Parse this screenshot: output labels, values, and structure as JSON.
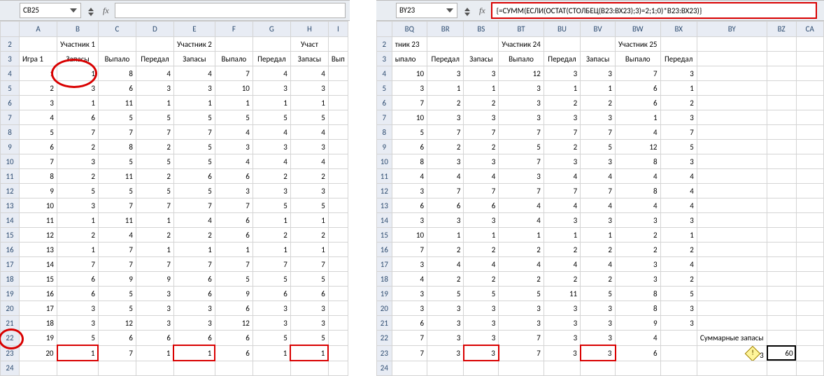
{
  "left": {
    "namebox": "CB25",
    "fx_symbol": "fx",
    "formula": "",
    "col_headers": [
      "A",
      "B",
      "C",
      "D",
      "E",
      "F",
      "G",
      "H",
      "I"
    ],
    "merged_headers_row2": [
      "",
      "Участник 1",
      "",
      "",
      "Участник 2",
      "",
      "",
      "Участ"
    ],
    "row2_first": "",
    "headers_row3": [
      "Игра 1",
      "Запасы",
      "Выпало",
      "Передал",
      "Запасы",
      "Выпало",
      "Передал",
      "Запасы",
      "Вып"
    ],
    "rows": [
      {
        "n": 4,
        "cells": [
          "1",
          "1",
          "8",
          "4",
          "4",
          "7",
          "4",
          "4",
          ""
        ]
      },
      {
        "n": 5,
        "cells": [
          "2",
          "3",
          "6",
          "3",
          "3",
          "10",
          "3",
          "3",
          ""
        ]
      },
      {
        "n": 6,
        "cells": [
          "3",
          "1",
          "11",
          "1",
          "1",
          "1",
          "1",
          "1",
          ""
        ]
      },
      {
        "n": 7,
        "cells": [
          "4",
          "6",
          "5",
          "5",
          "5",
          "5",
          "5",
          "5",
          ""
        ]
      },
      {
        "n": 8,
        "cells": [
          "5",
          "7",
          "7",
          "7",
          "7",
          "4",
          "4",
          "4",
          ""
        ]
      },
      {
        "n": 9,
        "cells": [
          "6",
          "2",
          "8",
          "2",
          "5",
          "3",
          "3",
          "3",
          ""
        ]
      },
      {
        "n": 10,
        "cells": [
          "7",
          "3",
          "5",
          "5",
          "5",
          "4",
          "4",
          "4",
          ""
        ]
      },
      {
        "n": 11,
        "cells": [
          "8",
          "2",
          "11",
          "2",
          "6",
          "6",
          "2",
          "2",
          ""
        ]
      },
      {
        "n": 12,
        "cells": [
          "9",
          "5",
          "5",
          "5",
          "5",
          "3",
          "3",
          "3",
          ""
        ]
      },
      {
        "n": 13,
        "cells": [
          "10",
          "3",
          "7",
          "7",
          "7",
          "7",
          "5",
          "5",
          ""
        ]
      },
      {
        "n": 14,
        "cells": [
          "11",
          "1",
          "11",
          "1",
          "4",
          "6",
          "1",
          "1",
          ""
        ]
      },
      {
        "n": 15,
        "cells": [
          "12",
          "2",
          "4",
          "2",
          "2",
          "6",
          "2",
          "2",
          ""
        ]
      },
      {
        "n": 16,
        "cells": [
          "13",
          "1",
          "7",
          "1",
          "1",
          "1",
          "1",
          "1",
          ""
        ]
      },
      {
        "n": 17,
        "cells": [
          "14",
          "7",
          "7",
          "7",
          "7",
          "7",
          "7",
          "7",
          ""
        ]
      },
      {
        "n": 18,
        "cells": [
          "15",
          "6",
          "9",
          "9",
          "6",
          "5",
          "5",
          "5",
          ""
        ]
      },
      {
        "n": 19,
        "cells": [
          "16",
          "6",
          "5",
          "3",
          "6",
          "9",
          "6",
          "6",
          ""
        ]
      },
      {
        "n": 20,
        "cells": [
          "17",
          "3",
          "5",
          "3",
          "3",
          "6",
          "3",
          "3",
          ""
        ]
      },
      {
        "n": 21,
        "cells": [
          "18",
          "3",
          "12",
          "3",
          "3",
          "12",
          "3",
          "3",
          ""
        ]
      },
      {
        "n": 22,
        "cells": [
          "19",
          "5",
          "6",
          "6",
          "6",
          "6",
          "5",
          "5",
          ""
        ]
      },
      {
        "n": 23,
        "cells": [
          "20",
          "1",
          "7",
          "1",
          "1",
          "6",
          "1",
          "1",
          ""
        ]
      },
      {
        "n": 24,
        "cells": [
          "",
          "",
          "",
          "",
          "",
          "",
          "",
          "",
          ""
        ]
      }
    ]
  },
  "right": {
    "namebox": "BY23",
    "fx_symbol": "fx",
    "formula": "{=СУММ(ЕСЛИ(ОСТАТ(СТОЛБЕЦ(B23:BX23);3)=2;1;0)*B23:BX23)}",
    "col_headers": [
      "BQ",
      "BR",
      "BS",
      "BT",
      "BU",
      "BV",
      "BW",
      "BX",
      "BY",
      "BZ",
      "CA"
    ],
    "merged_headers_row2": [
      "тник 23",
      "",
      "",
      "Участник 24",
      "",
      "",
      "Участник 25",
      "",
      "",
      "",
      ""
    ],
    "headers_row3": [
      "ыпало",
      "Передал",
      "Запасы",
      "Выпало",
      "Передал",
      "Запасы",
      "Выпало",
      "Передал",
      "",
      "",
      ""
    ],
    "rows": [
      {
        "n": 4,
        "cells": [
          "10",
          "3",
          "3",
          "12",
          "3",
          "3",
          "7",
          "3",
          "",
          "",
          ""
        ]
      },
      {
        "n": 5,
        "cells": [
          "3",
          "1",
          "1",
          "3",
          "1",
          "1",
          "6",
          "1",
          "",
          "",
          ""
        ]
      },
      {
        "n": 6,
        "cells": [
          "7",
          "2",
          "2",
          "3",
          "2",
          "2",
          "6",
          "2",
          "",
          "",
          ""
        ]
      },
      {
        "n": 7,
        "cells": [
          "10",
          "3",
          "3",
          "3",
          "3",
          "3",
          "1",
          "3",
          "",
          "",
          ""
        ]
      },
      {
        "n": 8,
        "cells": [
          "5",
          "7",
          "7",
          "7",
          "7",
          "7",
          "4",
          "7",
          "",
          "",
          ""
        ]
      },
      {
        "n": 9,
        "cells": [
          "6",
          "2",
          "2",
          "5",
          "2",
          "5",
          "12",
          "5",
          "",
          "",
          ""
        ]
      },
      {
        "n": 10,
        "cells": [
          "8",
          "3",
          "3",
          "7",
          "3",
          "3",
          "8",
          "3",
          "",
          "",
          ""
        ]
      },
      {
        "n": 11,
        "cells": [
          "4",
          "4",
          "4",
          "3",
          "4",
          "4",
          "4",
          "4",
          "",
          "",
          ""
        ]
      },
      {
        "n": 12,
        "cells": [
          "3",
          "7",
          "7",
          "7",
          "7",
          "7",
          "8",
          "4",
          "",
          "",
          ""
        ]
      },
      {
        "n": 13,
        "cells": [
          "6",
          "6",
          "6",
          "4",
          "4",
          "4",
          "4",
          "4",
          "",
          "",
          ""
        ]
      },
      {
        "n": 14,
        "cells": [
          "3",
          "3",
          "3",
          "4",
          "3",
          "3",
          "3",
          "3",
          "",
          "",
          ""
        ]
      },
      {
        "n": 15,
        "cells": [
          "10",
          "1",
          "1",
          "1",
          "1",
          "1",
          "2",
          "1",
          "",
          "",
          ""
        ]
      },
      {
        "n": 16,
        "cells": [
          "7",
          "2",
          "2",
          "2",
          "2",
          "2",
          "2",
          "2",
          "",
          "",
          ""
        ]
      },
      {
        "n": 17,
        "cells": [
          "3",
          "4",
          "4",
          "4",
          "4",
          "4",
          "3",
          "4",
          "",
          "",
          ""
        ]
      },
      {
        "n": 18,
        "cells": [
          "4",
          "2",
          "2",
          "2",
          "2",
          "2",
          "3",
          "2",
          "",
          "",
          ""
        ]
      },
      {
        "n": 19,
        "cells": [
          "3",
          "5",
          "5",
          "5",
          "11",
          "5",
          "8",
          "5",
          "",
          "",
          ""
        ]
      },
      {
        "n": 20,
        "cells": [
          "3",
          "3",
          "3",
          "3",
          "3",
          "3",
          "8",
          "3",
          "",
          "",
          ""
        ]
      },
      {
        "n": 21,
        "cells": [
          "6",
          "3",
          "3",
          "3",
          "3",
          "3",
          "9",
          "3",
          "",
          "",
          ""
        ]
      },
      {
        "n": 22,
        "cells": [
          "7",
          "3",
          "3",
          "7",
          "3",
          "3",
          "4",
          "",
          "Суммарные запасы",
          "",
          ""
        ]
      },
      {
        "n": 23,
        "cells": [
          "7",
          "3",
          "3",
          "7",
          "3",
          "3",
          "6",
          "",
          "3",
          "60",
          ""
        ]
      },
      {
        "n": 24,
        "cells": [
          "",
          "",
          "",
          "",
          "",
          "",
          "",
          "",
          "",
          "",
          ""
        ]
      }
    ],
    "summary_label": "Суммарные запасы",
    "summary_value": "60"
  }
}
